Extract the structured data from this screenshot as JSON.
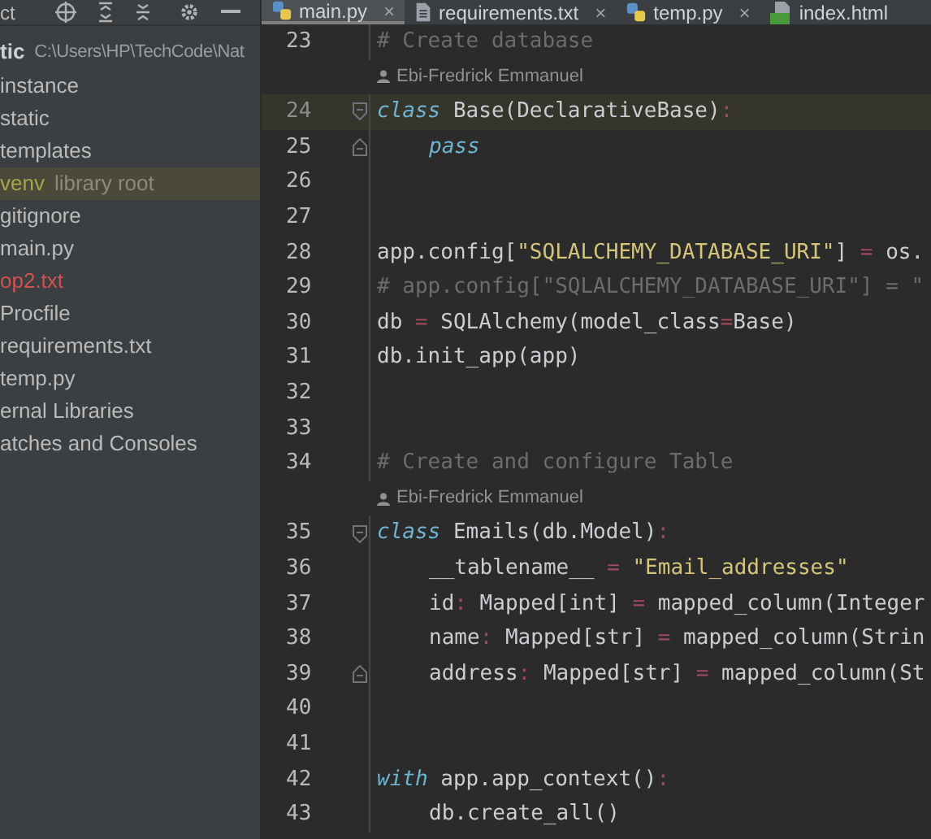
{
  "project_panel": {
    "header": "ct",
    "root": {
      "name": "tic",
      "path": "C:\\Users\\HP\\TechCode\\Nat"
    },
    "items": [
      {
        "label": "instance",
        "color": "#bbbbbb",
        "selected": false
      },
      {
        "label": "static",
        "color": "#bbbbbb",
        "selected": false
      },
      {
        "label": "templates",
        "color": "#bbbbbb",
        "selected": false
      },
      {
        "label": "venv",
        "note": "library root",
        "color": "#a8a64a",
        "selected": true
      },
      {
        "label": "gitignore",
        "color": "#bbbbbb",
        "selected": false
      },
      {
        "label": "main.py",
        "color": "#bbbbbb",
        "selected": false
      },
      {
        "label": "op2.txt",
        "color": "#d25252",
        "selected": false
      },
      {
        "label": "Procfile",
        "color": "#bbbbbb",
        "selected": false
      },
      {
        "label": "requirements.txt",
        "color": "#bbbbbb",
        "selected": false
      },
      {
        "label": "temp.py",
        "color": "#bbbbbb",
        "selected": false
      },
      {
        "label": "ernal Libraries",
        "color": "#bbbbbb",
        "selected": false
      },
      {
        "label": "atches and Consoles",
        "color": "#bbbbbb",
        "selected": false
      }
    ]
  },
  "tabs": [
    {
      "label": "main.py",
      "kind": "python",
      "selected": true,
      "close": "×"
    },
    {
      "label": "requirements.txt",
      "kind": "text",
      "selected": false,
      "close": "×"
    },
    {
      "label": "temp.py",
      "kind": "python",
      "selected": false,
      "close": "×"
    },
    {
      "label": "index.html",
      "kind": "html",
      "selected": false
    }
  ],
  "editor": {
    "lines": [
      {
        "kind": "code",
        "number": "23",
        "current": false,
        "tokens": [
          {
            "kind": "comment",
            "text": "# Create database"
          }
        ]
      },
      {
        "kind": "annotation",
        "author": "Ebi-Fredrick Emmanuel"
      },
      {
        "kind": "code",
        "number": "24",
        "current": true,
        "fold_start": true,
        "tokens": [
          {
            "kind": "keyword",
            "text": "class"
          },
          {
            "kind": "text",
            "text": " Base(DeclarativeBase)"
          },
          {
            "kind": "op",
            "text": ":"
          }
        ]
      },
      {
        "kind": "code",
        "number": "25",
        "current": false,
        "indented": true,
        "fold_end": true,
        "tokens": [
          {
            "kind": "keyword",
            "text": "pass"
          }
        ]
      },
      {
        "kind": "code",
        "number": "26",
        "current": false
      },
      {
        "kind": "code",
        "number": "27",
        "current": false
      },
      {
        "kind": "code",
        "number": "28",
        "current": false,
        "tokens": [
          {
            "kind": "text",
            "text": "app.config["
          },
          {
            "kind": "string",
            "text": "\"SQLALCHEMY_DATABASE_URI\""
          },
          {
            "kind": "text",
            "text": "] "
          },
          {
            "kind": "op",
            "text": "="
          },
          {
            "kind": "text",
            "text": " os."
          }
        ]
      },
      {
        "kind": "code",
        "number": "29",
        "current": false,
        "tokens": [
          {
            "kind": "comment",
            "text": "# app.config[\"SQLALCHEMY_DATABASE_URI\"] = \""
          }
        ]
      },
      {
        "kind": "code",
        "number": "30",
        "current": false,
        "tokens": [
          {
            "kind": "text",
            "text": "db "
          },
          {
            "kind": "op",
            "text": "="
          },
          {
            "kind": "text",
            "text": " SQLAlchemy(model_class"
          },
          {
            "kind": "op",
            "text": "="
          },
          {
            "kind": "text",
            "text": "Base)"
          }
        ]
      },
      {
        "kind": "code",
        "number": "31",
        "current": false,
        "tokens": [
          {
            "kind": "text",
            "text": "db.init_app(app)"
          }
        ]
      },
      {
        "kind": "code",
        "number": "32",
        "current": false
      },
      {
        "kind": "code",
        "number": "33",
        "current": false
      },
      {
        "kind": "code",
        "number": "34",
        "current": false,
        "tokens": [
          {
            "kind": "comment",
            "text": "# Create and configure Table"
          }
        ]
      },
      {
        "kind": "annotation",
        "author": "Ebi-Fredrick Emmanuel"
      },
      {
        "kind": "code",
        "number": "35",
        "current": false,
        "fold_start": true,
        "tokens": [
          {
            "kind": "keyword",
            "text": "class"
          },
          {
            "kind": "text",
            "text": " Emails(db.Model)"
          },
          {
            "kind": "op",
            "text": ":"
          }
        ]
      },
      {
        "kind": "code",
        "number": "36",
        "current": false,
        "indented": true,
        "tokens": [
          {
            "kind": "text",
            "text": "__tablename__ "
          },
          {
            "kind": "op",
            "text": "="
          },
          {
            "kind": "string",
            "text": " \"Email_addresses\""
          }
        ]
      },
      {
        "kind": "code",
        "number": "37",
        "current": false,
        "indented": true,
        "tokens": [
          {
            "kind": "text",
            "text": "id"
          },
          {
            "kind": "op",
            "text": ":"
          },
          {
            "kind": "text",
            "text": " Mapped[int] "
          },
          {
            "kind": "op",
            "text": "="
          },
          {
            "kind": "text",
            "text": " mapped_column(Integer"
          }
        ]
      },
      {
        "kind": "code",
        "number": "38",
        "current": false,
        "indented": true,
        "tokens": [
          {
            "kind": "text",
            "text": "name"
          },
          {
            "kind": "op",
            "text": ":"
          },
          {
            "kind": "text",
            "text": " Mapped[str] "
          },
          {
            "kind": "op",
            "text": "="
          },
          {
            "kind": "text",
            "text": " mapped_column(Strin"
          }
        ]
      },
      {
        "kind": "code",
        "number": "39",
        "current": false,
        "indented": true,
        "fold_end": true,
        "tokens": [
          {
            "kind": "text",
            "text": "address"
          },
          {
            "kind": "op",
            "text": ":"
          },
          {
            "kind": "text",
            "text": " Mapped[str] "
          },
          {
            "kind": "op",
            "text": "="
          },
          {
            "kind": "text",
            "text": " mapped_column(St"
          }
        ]
      },
      {
        "kind": "code",
        "number": "40",
        "current": false
      },
      {
        "kind": "code",
        "number": "41",
        "current": false
      },
      {
        "kind": "code",
        "number": "42",
        "current": false,
        "tokens": [
          {
            "kind": "keyword",
            "text": "with"
          },
          {
            "kind": "text",
            "text": " app.app_context()"
          },
          {
            "kind": "op",
            "text": ":"
          }
        ]
      },
      {
        "kind": "code",
        "number": "43",
        "current": false,
        "indented": true,
        "tokens": [
          {
            "kind": "text",
            "text": "db.create_all()"
          }
        ]
      }
    ]
  }
}
